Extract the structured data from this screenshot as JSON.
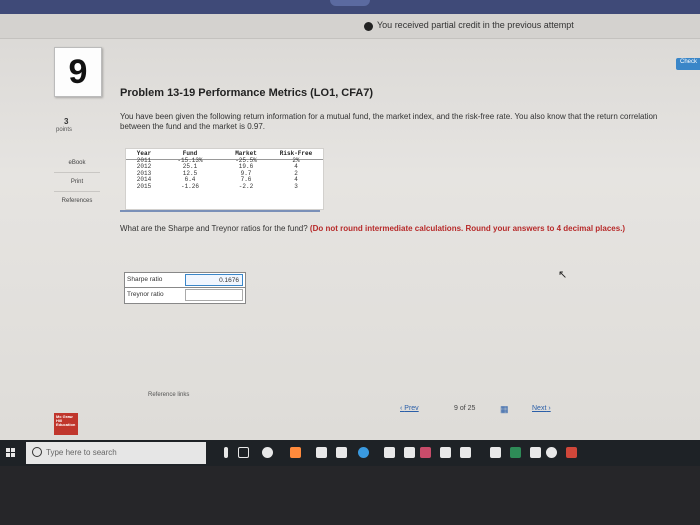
{
  "notice": {
    "text": "You received partial credit in the previous attempt"
  },
  "check_label": "Check",
  "question_number": "9",
  "problem_title": "Problem 13-19 Performance Metrics (LO1, CFA7)",
  "points": {
    "value": "3",
    "label": "points"
  },
  "sidebar": {
    "items": [
      {
        "label": "eBook"
      },
      {
        "label": "Print"
      },
      {
        "label": "References"
      }
    ]
  },
  "intro_text": "You have been given the following return information for a mutual fund, the market index, and the risk-free rate. You also know that the return correlation between the fund and the market is 0.97.",
  "table": {
    "headers": [
      "Year",
      "Fund",
      "Market",
      "Risk-Free"
    ],
    "rows": [
      [
        "2011",
        "-15.13%",
        "-25.5%",
        "2%"
      ],
      [
        "2012",
        "25.1",
        "19.6",
        "4"
      ],
      [
        "2013",
        "12.5",
        "9.7",
        "2"
      ],
      [
        "2014",
        "6.4",
        "7.6",
        "4"
      ],
      [
        "2015",
        "-1.26",
        "-2.2",
        "3"
      ]
    ]
  },
  "question": {
    "text": "What are the Sharpe and Treynor ratios for the fund?",
    "instruction": "(Do not round intermediate calculations. Round your answers to 4 decimal places.)"
  },
  "answers": [
    {
      "label": "Sharpe ratio",
      "value": "0.1676"
    },
    {
      "label": "Treynor ratio",
      "value": ""
    }
  ],
  "reference_links": "Reference links",
  "pager": {
    "prev": "Prev",
    "position": "9 of 25",
    "next": "Next"
  },
  "logo_text": "Mc Graw Hill Education",
  "taskbar": {
    "search_placeholder": "Type here to search"
  }
}
